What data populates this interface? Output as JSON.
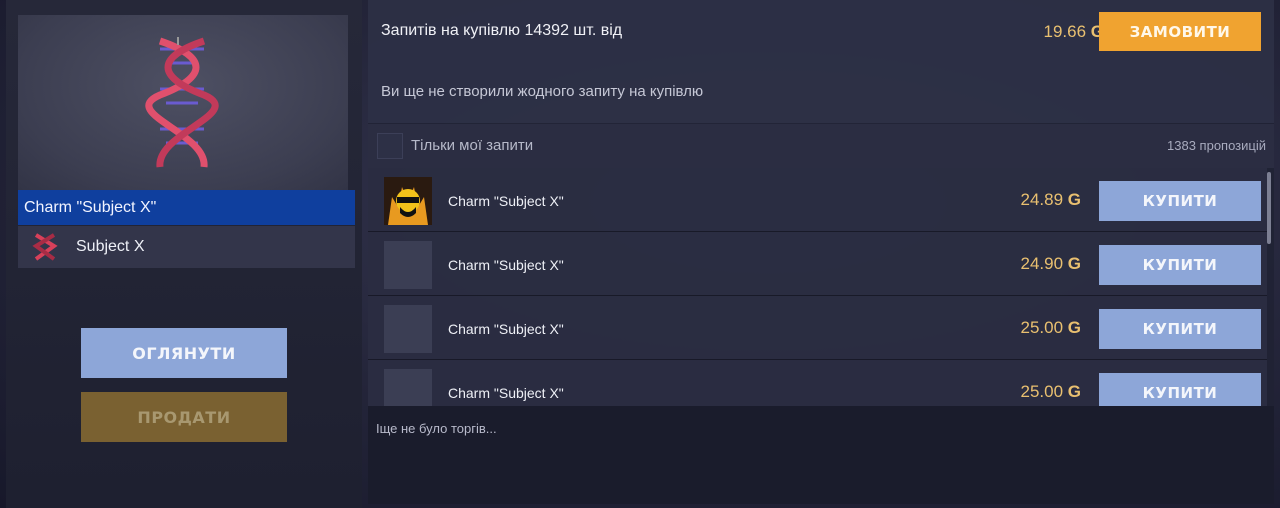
{
  "item": {
    "name": "Charm \"Subject X\"",
    "collection": "Subject X"
  },
  "actions": {
    "inspect_label": "ОГЛЯНУТИ",
    "sell_label": "ПРОДАТИ"
  },
  "order": {
    "text": "Запитів на купівлю 14392 шт. від",
    "price": "19.66",
    "currency_symbol": "G",
    "button_label": "ЗАМОВИТИ",
    "no_requests": "Ви ще не створили жодного запиту на купівлю"
  },
  "filter": {
    "label": "Тільки мої запити",
    "checked": false,
    "offers_count": "1383 пропозицій"
  },
  "listings": [
    {
      "name": "Charm \"Subject X\"",
      "price": "24.89",
      "currency": "G",
      "button": "КУПИТИ",
      "avatar": "seller-avatar-icon"
    },
    {
      "name": "Charm \"Subject X\"",
      "price": "24.90",
      "currency": "G",
      "button": "КУПИТИ",
      "avatar": ""
    },
    {
      "name": "Charm \"Subject X\"",
      "price": "25.00",
      "currency": "G",
      "button": "КУПИТИ",
      "avatar": ""
    },
    {
      "name": "Charm \"Subject X\"",
      "price": "25.00",
      "currency": "G",
      "button": "КУПИТИ",
      "avatar": ""
    }
  ],
  "trades": {
    "empty_text": "Іще не було торгів..."
  },
  "colors": {
    "accent_orange": "#f0a330",
    "buy_blue": "#8da6d8",
    "price_gold": "#e9c070",
    "selected_blue": "#0f3f9e"
  }
}
